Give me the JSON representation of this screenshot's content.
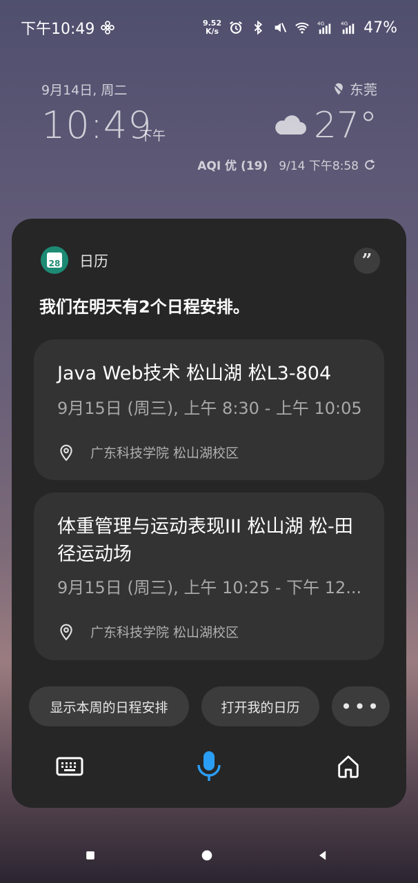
{
  "status_bar": {
    "time": "下午10:49",
    "net_speed_value": "9.52",
    "net_speed_unit": "K/s",
    "net_1": "4G",
    "net_2": "4G",
    "battery": "47%"
  },
  "widget": {
    "date": "9月14日, 周二",
    "time": "10:49",
    "ampm": "下午",
    "city": "东莞",
    "temperature": "27°",
    "aqi": "AQI 优 (19)",
    "updated": "9/14 下午8:58"
  },
  "assistant": {
    "app_icon_day": "28",
    "app_name": "日历",
    "quote_symbol": "”",
    "headline": "我们在明天有2个日程安排。",
    "events": [
      {
        "title": "Java Web技术 松山湖 松L3-804",
        "time": "9月15日 (周三), 上午 8:30 - 上午 10:05",
        "location": "广东科技学院 松山湖校区"
      },
      {
        "title": "体重管理与运动表现III 松山湖 松-田径运动场",
        "time": "9月15日 (周三), 上午 10:25 - 下午 12...",
        "location": "广东科技学院 松山湖校区"
      }
    ],
    "chips": {
      "week_schedule": "显示本周的日程安排",
      "open_calendar": "打开我的日历",
      "more": "•••"
    }
  },
  "colors": {
    "panel_bg": "#262626",
    "card_bg": "#333333",
    "chip_bg": "#3c3c3c",
    "mic_accent": "#2a9df4",
    "calendar_green": "#1d8a74"
  }
}
